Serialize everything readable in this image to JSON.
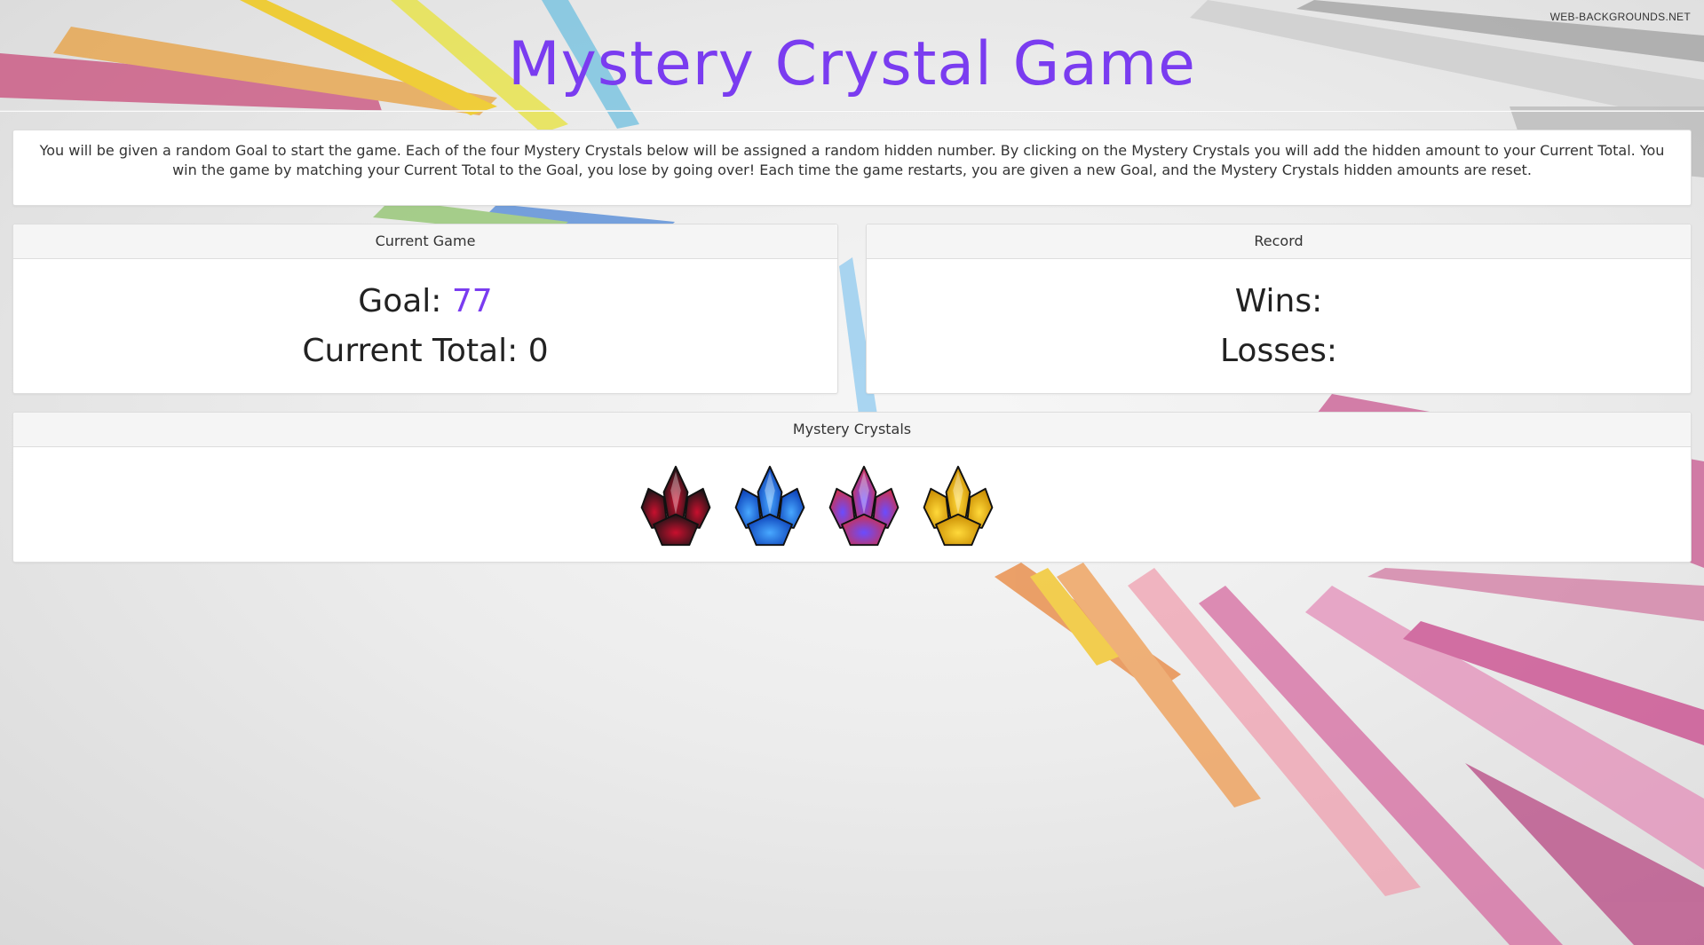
{
  "watermark": "WEB-BACKGROUNDS.NET",
  "title": "Mystery Crystal Game",
  "instructions": "You will be given a random Goal to start the game. Each of the four Mystery Crystals below will be assigned a random hidden number. By clicking on the Mystery Crystals you will add the hidden amount to your Current Total. You win the game by matching your Current Total to the Goal, you lose by going over! Each time the game restarts, you are given a new Goal, and the Mystery Crystals hidden amounts are reset.",
  "current_game": {
    "heading": "Current Game",
    "goal_label": "Goal:",
    "goal_value": "77",
    "total_label": "Current Total:",
    "total_value": "0"
  },
  "record": {
    "heading": "Record",
    "wins_label": "Wins:",
    "losses_label": "Losses:"
  },
  "crystals": {
    "heading": "Mystery Crystals",
    "items": [
      {
        "name": "red-black-crystal",
        "colors": [
          "#1a1416",
          "#c8102e"
        ]
      },
      {
        "name": "blue-crystal",
        "colors": [
          "#0b3fb8",
          "#48a8ff"
        ]
      },
      {
        "name": "pink-purple-crystal",
        "colors": [
          "#d0304c",
          "#6a4cff"
        ]
      },
      {
        "name": "gold-crystal",
        "colors": [
          "#c88a00",
          "#ffd93a"
        ]
      }
    ]
  },
  "colors": {
    "accent": "#7a3cf0"
  }
}
